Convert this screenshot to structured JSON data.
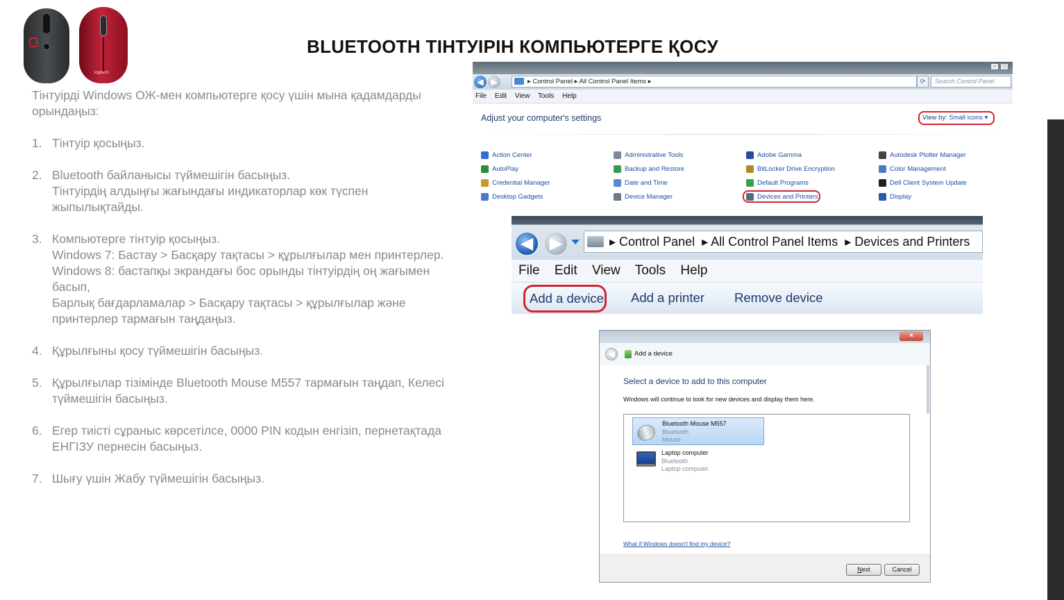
{
  "slide": {
    "title": "BLUETOOTH ТІНТУІРІН  КОМПЬЮТЕРГЕ ҚОСУ",
    "intro": "Тінтуірді Windows ОЖ-мен компьютерге қосу үшін мына қадамдарды орындаңыз:",
    "steps": [
      {
        "num": "1.",
        "lines": [
          "Тінтуір қосыңыз."
        ]
      },
      {
        "num": "2.",
        "lines": [
          "Bluetooth байланысы түймешігін басыңыз.",
          "Тінтуірдің алдыңғы жағындағы индикаторлар  көк түспен жыпылықтайды."
        ]
      },
      {
        "num": "3.",
        "lines": [
          "Компьютерге тінтуір қосыңыз.",
          "Windows 7: Бастау > Басқару тақтасы > құрылғылар мен принтерлер.",
          "Windows 8: бастапқы экрандағы бос орынды тінтуірдің оң жағымен басып,",
          "Барлық бағдарламалар  > Басқару тақтасы > құрылғылар және принтерлер тармағын таңдаңыз."
        ]
      },
      {
        "num": "4.",
        "lines": [
          "Құрылғыны қосу түймешігін басыңыз."
        ]
      },
      {
        "num": "5.",
        "lines": [
          "Құрылғылар тізімінде Bluetooth Mouse M557 тармағын таңдап, Келесі түймешігін басыңыз."
        ]
      },
      {
        "num": "6.",
        "lines": [
          "Егер тиісті сұраныс көрсетілсе, 0000 PIN кодын енгізіп, пернетақтада ЕНГІЗУ пернесін басыңыз."
        ]
      },
      {
        "num": "7.",
        "lines": [
          "Шығу үшін Жабу түймешігін басыңыз."
        ]
      }
    ],
    "mouse_logo_text": "logitech"
  },
  "control_panel": {
    "window_buttons": [
      "–",
      "□",
      "×"
    ],
    "breadcrumb": "▸ Control Panel ▸ All Control Panel Items ▸",
    "refresh_icon": "⟳",
    "search_placeholder": "Search Control Panel",
    "menu": [
      "File",
      "Edit",
      "View",
      "Tools",
      "Help"
    ],
    "heading": "Adjust your computer's settings",
    "view_by_label": "View by:",
    "view_by_value": "Small icons ▾",
    "items": [
      {
        "label": "Action Center",
        "icon": "flag-icon",
        "color": "#2f6fd0"
      },
      {
        "label": "Administrative Tools",
        "icon": "tools-icon",
        "color": "#7a8a9a"
      },
      {
        "label": "Adobe Gamma",
        "icon": "monitor-icon",
        "color": "#2a4aa0"
      },
      {
        "label": "Autodesk Plotter Manager",
        "icon": "plotter-icon",
        "color": "#444444"
      },
      {
        "label": "AutoPlay",
        "icon": "autoplay-icon",
        "color": "#2f8a3a"
      },
      {
        "label": "Backup and Restore",
        "icon": "backup-icon",
        "color": "#3a9a4a"
      },
      {
        "label": "BitLocker Drive Encryption",
        "icon": "key-icon",
        "color": "#b08a2a"
      },
      {
        "label": "Color Management",
        "icon": "color-icon",
        "color": "#4a7ac8"
      },
      {
        "label": "Credential Manager",
        "icon": "vault-icon",
        "color": "#c89a2a"
      },
      {
        "label": "Date and Time",
        "icon": "clock-icon",
        "color": "#5a8ac8"
      },
      {
        "label": "Default Programs",
        "icon": "default-programs-icon",
        "color": "#3aa04a"
      },
      {
        "label": "Dell Client System Update",
        "icon": "update-icon",
        "color": "#222222"
      },
      {
        "label": "Desktop Gadgets",
        "icon": "gadgets-icon",
        "color": "#4a7ac8"
      },
      {
        "label": "Device Manager",
        "icon": "device-manager-icon",
        "color": "#6a7a8a"
      },
      {
        "label": "Devices and Printers",
        "icon": "printer-icon",
        "color": "#5a6a7a"
      },
      {
        "label": "Display",
        "icon": "display-icon",
        "color": "#2a5ab0"
      }
    ]
  },
  "devices_printers": {
    "breadcrumb": [
      "Control Panel",
      "All Control Panel Items",
      "Devices and Printers"
    ],
    "menu": [
      "File",
      "Edit",
      "View",
      "Tools",
      "Help"
    ],
    "toolbar": {
      "add_device": "Add a device",
      "add_printer": "Add a printer",
      "remove_device": "Remove device"
    }
  },
  "add_device_dialog": {
    "close_label": "×",
    "window_title": "Add a device",
    "heading": "Select a device to add to this computer",
    "subtext": "Windows will continue to look for new devices and display them here.",
    "devices": [
      {
        "name": "Bluetooth Mouse M557",
        "type": "Bluetooth",
        "category": "Mouse"
      },
      {
        "name": "Laptop computer",
        "type": "Bluetooth",
        "category": "Laptop computer"
      }
    ],
    "help_link": "What if Windows doesn't find my device?",
    "next_label": "Next",
    "cancel_label": "Cancel"
  }
}
